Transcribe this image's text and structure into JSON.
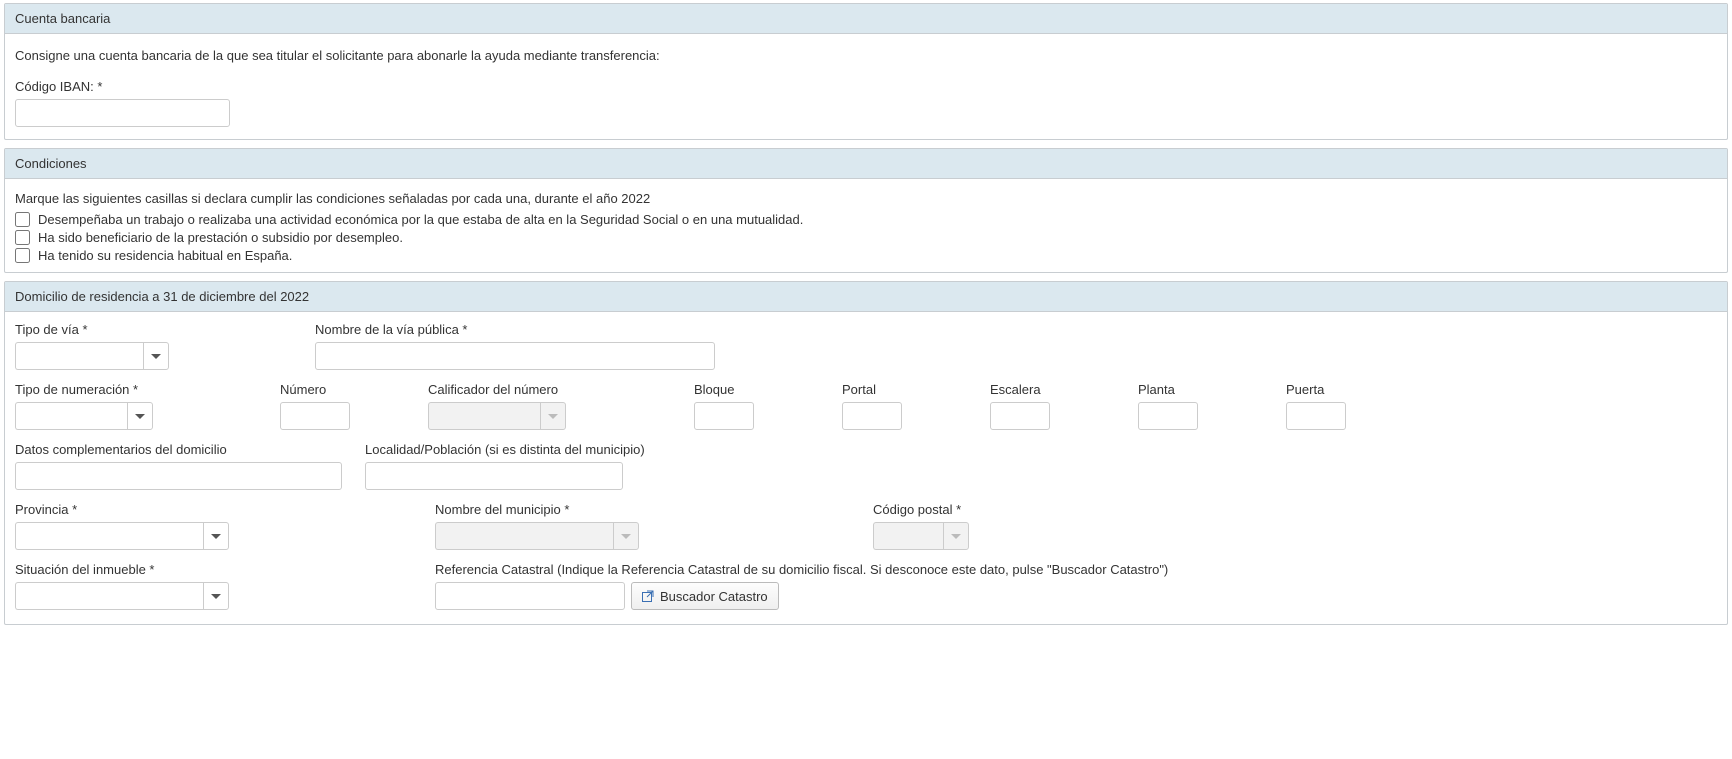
{
  "section1": {
    "title": "Cuenta bancaria",
    "instruction": "Consigne una cuenta bancaria de la que sea titular el solicitante para abonarle la ayuda mediante transferencia:",
    "iban_label": "Código IBAN: *"
  },
  "section2": {
    "title": "Condiciones",
    "instruction": "Marque las siguientes casillas si declara cumplir las condiciones señaladas por cada una, durante el año 2022",
    "opt1": "Desempeñaba un trabajo o realizaba una actividad económica por la que estaba de alta en la Seguridad Social o en una mutualidad.",
    "opt2": "Ha sido beneficiario de la prestación o subsidio por desempleo.",
    "opt3": "Ha tenido su residencia habitual en España."
  },
  "section3": {
    "title": "Domicilio de residencia a 31 de diciembre del 2022",
    "tipo_via": "Tipo de vía *",
    "nombre_via": "Nombre de la vía pública *",
    "tipo_num": "Tipo de numeración *",
    "numero": "Número",
    "calificador": "Calificador del número",
    "bloque": "Bloque",
    "portal": "Portal",
    "escalera": "Escalera",
    "planta": "Planta",
    "puerta": "Puerta",
    "datos_comp": "Datos complementarios del domicilio",
    "localidad": "Localidad/Población (si es distinta del municipio)",
    "provincia": "Provincia *",
    "municipio": "Nombre del municipio *",
    "cpostal": "Código postal *",
    "situacion": "Situación del inmueble *",
    "ref_cat_label": "Referencia Catastral (Indique la Referencia Catastral de su domicilio fiscal. Si desconoce este dato, pulse \"Buscador Catastro\")",
    "buscador_btn": "Buscador Catastro"
  }
}
